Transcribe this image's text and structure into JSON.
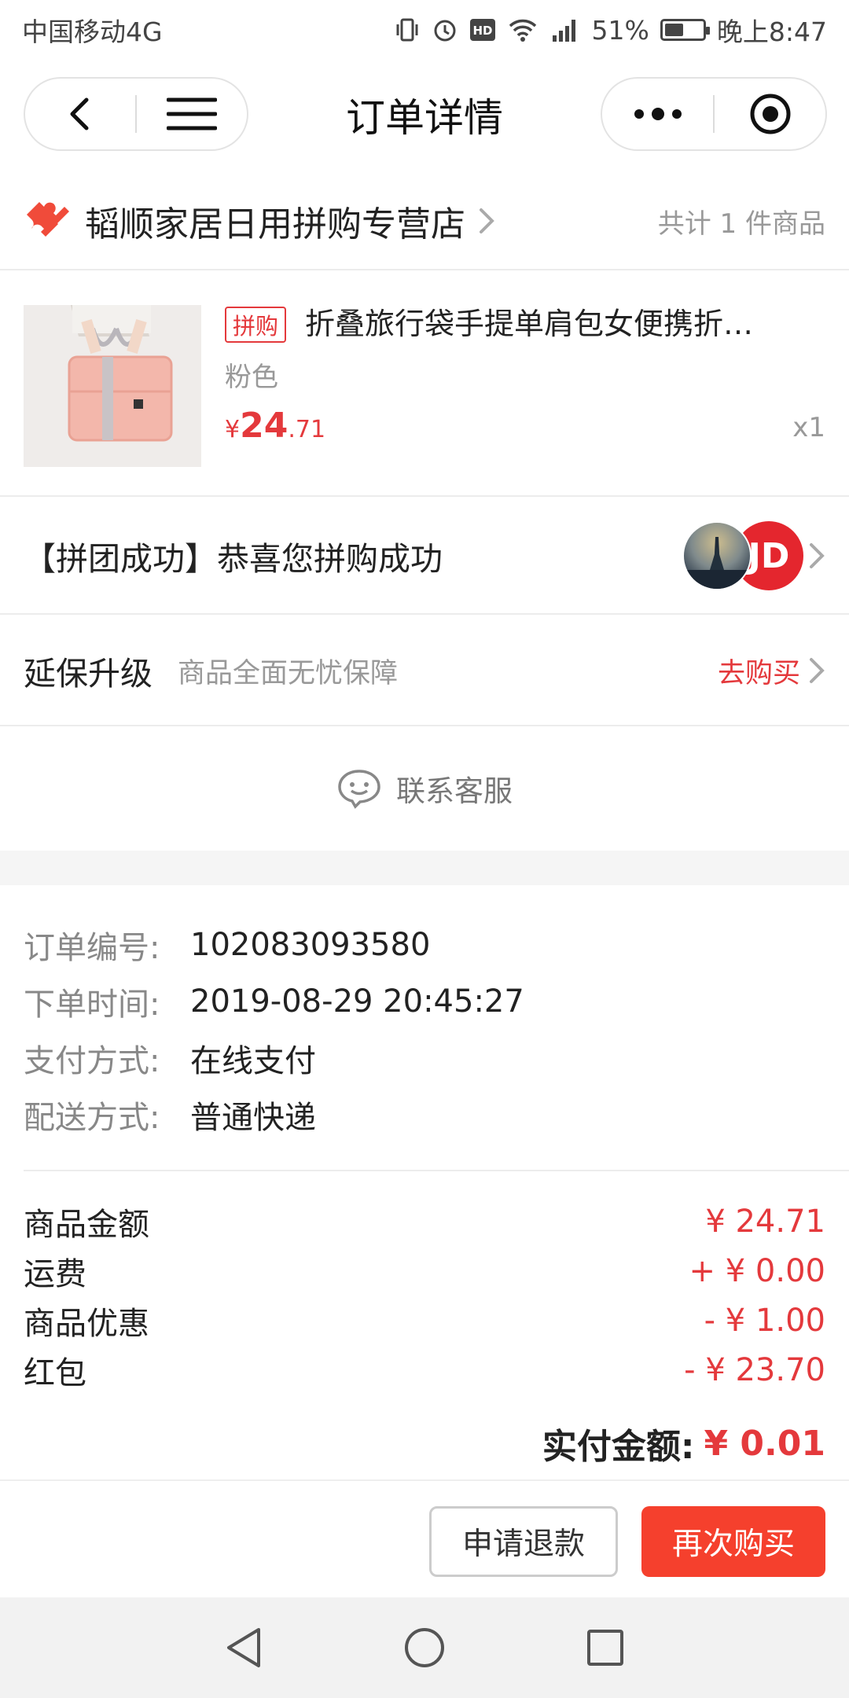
{
  "status_bar": {
    "carrier": "中国移动4G",
    "battery_percent": "51%",
    "battery_level": 0.51,
    "time": "晚上8:47",
    "icons": [
      "vibrate-icon",
      "alarm-icon",
      "hd-icon",
      "wifi-icon",
      "signal-icon",
      "battery-icon"
    ]
  },
  "nav": {
    "title": "订单详情",
    "icons": [
      "back-icon",
      "menu-icon",
      "more-icon",
      "target-icon"
    ]
  },
  "shop": {
    "name": "韬顺家居日用拼购专营店",
    "item_count": "共计 1 件商品"
  },
  "product": {
    "tag": "拼购",
    "title": "折叠旅行袋手提单肩包女便携折…",
    "variant": "粉色",
    "price_symbol": "¥",
    "price_int": "24",
    "price_dec": ".71",
    "quantity": "x1"
  },
  "group": {
    "text": "【拼团成功】恭喜您拼购成功",
    "jd_label": "JD"
  },
  "warranty": {
    "title": "延保升级",
    "subtitle": "商品全面无忧保障",
    "link": "去购买"
  },
  "contact": {
    "label": "联系客服"
  },
  "order_info": [
    {
      "label": "订单编号:",
      "value": "102083093580"
    },
    {
      "label": "下单时间:",
      "value": "2019-08-29 20:45:27"
    },
    {
      "label": "支付方式:",
      "value": "在线支付"
    },
    {
      "label": "配送方式:",
      "value": "普通快递"
    }
  ],
  "fees": [
    {
      "label": "商品金额",
      "value": "¥ 24.71"
    },
    {
      "label": "运费",
      "value": "+ ¥ 0.00"
    },
    {
      "label": "商品优惠",
      "value": "- ¥ 1.00"
    },
    {
      "label": "红包",
      "value": "- ¥ 23.70"
    }
  ],
  "total": {
    "label": "实付金额:",
    "value": "¥ 0.01"
  },
  "actions": {
    "refund": "申请退款",
    "rebuy": "再次购买"
  },
  "colors": {
    "accent": "#e4393c",
    "button_red": "#f5402d"
  }
}
